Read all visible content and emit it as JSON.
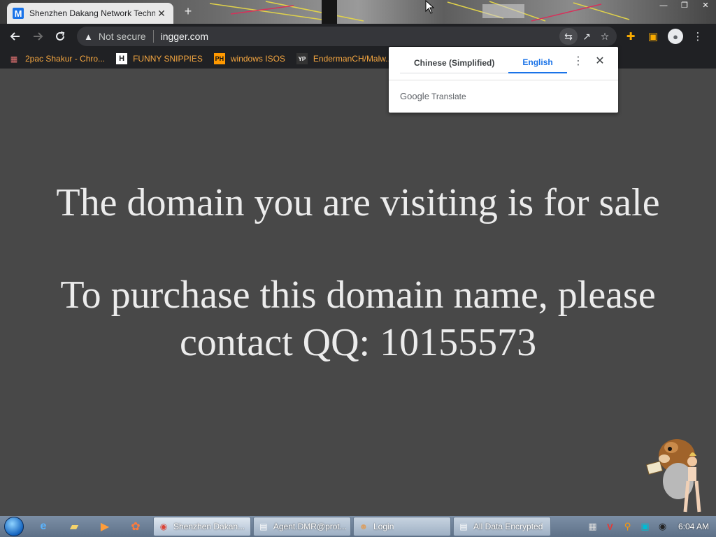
{
  "browser": {
    "tab": {
      "favicon_letter": "M",
      "title": "Shenzhen Dakang Network Techn",
      "close": "✕"
    },
    "new_tab": "+",
    "window_controls": [
      "—",
      "❐",
      "✕"
    ],
    "toolbar": {
      "security_label": "Not secure",
      "url": "ingger.com"
    },
    "bookmarks": [
      {
        "label": "2pac Shakur - Chro...",
        "icon": "bookmark-calendar-icon",
        "icon_text": "▦",
        "icon_color": "#e57373"
      },
      {
        "label": "FUNNY SNIPPIES",
        "icon": "bookmark-h-icon",
        "icon_text": "H",
        "icon_color": "#ffffff"
      },
      {
        "label": "windows ISOS",
        "icon": "bookmark-ph-icon",
        "icon_text": "PH",
        "icon_color": "#f90"
      },
      {
        "label": "EndermanCH/Malw...",
        "icon": "bookmark-yp-icon",
        "icon_text": "YP",
        "icon_color": "#ffffff"
      }
    ]
  },
  "translate_popup": {
    "tabs": [
      "Chinese (Simplified)",
      "English"
    ],
    "active_tab": "English",
    "footer_brand": "Google",
    "footer_product": "Translate"
  },
  "page": {
    "headline": "The domain you are visiting is for sale",
    "contact_line1": "To purchase this domain name, please",
    "contact_line2": "contact QQ: 10155573"
  },
  "taskbar": {
    "buttons": [
      {
        "label": "Shenzhen Dakan...",
        "icon": "chrome-icon"
      },
      {
        "label": "Agent.DMR@prot...",
        "icon": "window-app-icon"
      },
      {
        "label": "Login",
        "icon": "user-icon"
      },
      {
        "label": "All Data Encrypted",
        "icon": "window-app-icon"
      }
    ],
    "clock": "6:04 AM"
  },
  "colors": {
    "page_bg": "#484848",
    "page_text": "#ececec",
    "chrome_dark": "#202124",
    "bookmark_text": "#f4a640",
    "accent_blue": "#1a73e8"
  }
}
